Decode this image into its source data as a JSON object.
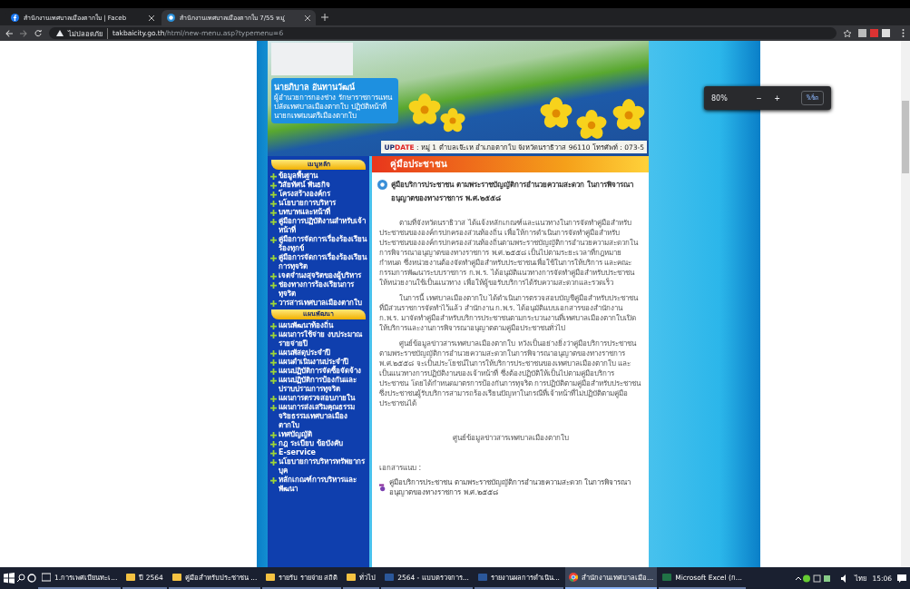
{
  "browser": {
    "tabs": [
      {
        "title": "สำนักงานเทศบาลเมืองตากใบ | Faceb",
        "selected": false
      },
      {
        "title": "สำนักงานเทศบาลเมืองตากใบ 7/55 หมู่",
        "selected": true
      }
    ],
    "security": "ไม่ปลอดภัย",
    "url_host": "takbaicity.go.th",
    "url_path": "/html/new-menu.asp?typemenu=6",
    "zoom_popup": {
      "value": "80%",
      "minus": "−",
      "plus": "+",
      "reset": "รีเซ็ต"
    }
  },
  "header": {
    "name": "นายภิบาล อันทานวัฒน์",
    "position": "ผู้อำนวยการกองช่าง รักษาราชการแทนปลัดเทศบาลเมืองตากใบ ปฏิบัติหน้าที่นายกเทศมนตรีเมืองตากใบ",
    "update_label_a": "UP",
    "update_label_b": "DATE",
    "update_text": ": หมู่ 1 ตำบลเจ๊ะเห อำเภอตากใบ จังหวัดนราธิวาส 96110 โทรศัพท์ : 073-5"
  },
  "sidebar": [
    {
      "heading": "เมนูหลัก",
      "items": [
        "ข้อมูลพื้นฐาน",
        "วิสัยทัศน์ พันธกิจ",
        "โครงสร้างองค์กร",
        "นโยบายการบริหาร",
        "บทบาทและหน้าที่",
        "คู่มือการปฏิบัติงานสำหรับเจ้าหน้าที่",
        "คู่มือการจัดการเรื่องร้องเรียนร้องทุกข์",
        "คู่มือการจัดการเรื่องร้องเรียนการทุจริต",
        "เจตจำนงสุจริตของผู้บริหาร",
        "ช่องทางการร้องเรียนการทุจริต",
        "วารสารเทศบาลเมืองตากใบ"
      ]
    },
    {
      "heading": "แผนพัฒนา",
      "items": [
        "แผนพัฒนาท้องถิ่น",
        "แผนการใช้จ่าย งบประมาณรายจ่ายปี",
        "แผนพัสดุประจำปี",
        "แผนดำเนินงานประจำปี",
        "แผนปฏิบัติการจัดซื้อจัดจ้าง",
        "แผนปฏิบัติการป้องกันและปราบปรามการทุจริต",
        "แผนการตรวจสอบภายใน",
        "แผนการส่งเสริมคุณธรรมจริยธรรมเทศบาลเมืองตากใบ",
        "เทศบัญญัติ",
        "กฎ ระเบียบ ข้อบังคับ",
        "E-service",
        "นโยบายการบริหารทรัพยากรบุค",
        "หลักเกณฑ์การบริหารและพัฒนา"
      ]
    }
  ],
  "content": {
    "section_title": "คู่มือประชาชน",
    "article_title": "คู่มือบริการประชาชน ตามพระราชบัญญัติการอำนวยความสะดวก ในการพิจารณาอนุญาตของทางราชการ พ.ศ.๒๕๕๘",
    "paragraphs": [
      "ตามที่จังหวัดนราธิวาส ได้แจ้งหลักเกณฑ์และแนวทางในการจัดทำคู่มือสำหรับประชาชนขององค์กรปกครองส่วนท้องถิ่น เพื่อให้การดำเนินการจัดทำคู่มือสำหรับประชาชนขององค์กรปกครองส่วนท้องถิ่นตามพระราชบัญญัติการอำนวยความสะดวกในการพิจารณาอนุญาตของทางราชการ พ.ศ.๒๕๕๘ เป็นไปตามระยะเวลาที่กฎหมายกำหนด ซึ่งหน่วยงานต้องจัดทำคู่มือสำหรับประชาชนเพื่อใช้ในการให้บริการ และคณะกรรมการพัฒนาระบบราชการ ก.พ.ร. ได้อนุมัติแนวทางการจัดทำคู่มือสำหรับประชาชน ให้หน่วยงานใช้เป็นแนวทาง เพื่อให้ผู้ขอรับบริการได้รับความสะดวกและรวดเร็ว",
      "ในการนี้ เทศบาลเมืองตากใบ ได้ดำเนินการตรวจสอบบัญชีคู่มือสำหรับประชาชนที่มีส่วนราชการจัดทำไว้แล้ว สำนักงาน ก.พ.ร. ได้อนุมัติแบบเอกสารของสำนักงาน ก.พ.ร. มาจัดทำคู่มือสำหรับบริการประชาชนตามกระบวนงานที่เทศบาลเมืองตากใบเปิดให้บริการและงานการพิจารณาอนุญาตตามคู่มือประชาชนทั่วไป",
      "ศูนย์ข้อมูลข่าวสารเทศบาลเมืองตากใบ หวังเป็นอย่างยิ่งว่าคู่มือบริการประชาชน ตามพระราชบัญญัติการอำนวยความสะดวกในการพิจารณาอนุญาตของทางราชการ พ.ศ.๒๕๕๘ จะเป็นประโยชน์ในการให้บริการประชาชนของเทศบาลเมืองตากใบ และเป็นแนวทางการปฏิบัติงานของเจ้าหน้าที่ ซึ่งต้องปฏิบัติให้เป็นไปตามคู่มือบริการประชาชน โดยได้กำหนดมาตรการป้องกันการทุจริต การปฏิบัติตามคู่มือสำหรับประชาชน ซึ่งประชาชนผู้รับบริการสามารถร้องเรียนปัญหาในกรณีที่เจ้าหน้าที่ไม่ปฏิบัติตามคู่มือประชาชนได้"
    ],
    "signature": "ศูนย์ข้อมูลข่าวสารเทศบาลเมืองตากใบ",
    "attachments_label": "เอกสารแนบ :",
    "attachments": [
      "คู่มือบริการประชาชน ตามพระราชบัญญัติการอำนวยความสะดวก ในการพิจารณาอนุญาตของทางราชการ พ.ศ.๒๕๕๘"
    ]
  },
  "taskbar": {
    "apps": [
      {
        "label": "1.การเพศเบียนทะเ...",
        "kind": "explorer",
        "selected": false
      },
      {
        "label": "ปี 2564",
        "kind": "folder",
        "selected": false
      },
      {
        "label": "คู่มือสำหรับประชาชน ...",
        "kind": "folder",
        "selected": false
      },
      {
        "label": "รายรับ รายจ่าย สถิติ",
        "kind": "folder",
        "selected": false
      },
      {
        "label": "ทั่วไป",
        "kind": "folder",
        "selected": false
      },
      {
        "label": "2564 - แบบตรวจการ...",
        "kind": "word",
        "selected": false
      },
      {
        "label": "รายงานผลการดำเนิน...",
        "kind": "word",
        "selected": false
      },
      {
        "label": "สำนักงานเทศบาลเมือ...",
        "kind": "chrome",
        "selected": true
      },
      {
        "label": "Microsoft Excel (ก...",
        "kind": "excel",
        "selected": false
      }
    ],
    "language": "ไทย",
    "time": "15:06"
  }
}
